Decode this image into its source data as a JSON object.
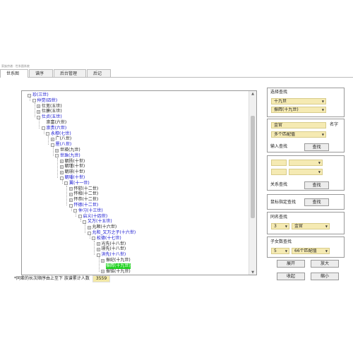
{
  "window": {
    "title": "家族宗谱 · 世系图系统"
  },
  "tabs": [
    "世系图",
    "谱序",
    "后台管理",
    "后记"
  ],
  "tree": {
    "nodes": [
      {
        "label": "珍(三世)",
        "level": 0,
        "toggle": "-",
        "blue": true
      },
      {
        "label": "仲觉(四世)",
        "level": 1,
        "toggle": "-",
        "blue": true
      },
      {
        "label": "仕宽(五世)",
        "level": 2,
        "toggle": "+",
        "blue": false
      },
      {
        "label": "仕廉(五世)",
        "level": 2,
        "toggle": "+",
        "blue": false
      },
      {
        "label": "仕贞(五世)",
        "level": 2,
        "toggle": "-",
        "blue": true
      },
      {
        "label": "崇富(六世)",
        "level": 3,
        "toggle": "",
        "blue": false
      },
      {
        "label": "崇贵(六世)",
        "level": 3,
        "toggle": "-",
        "blue": true
      },
      {
        "label": "永穆(七世)",
        "level": 4,
        "toggle": "-",
        "blue": true
      },
      {
        "label": "广(八世)",
        "level": 5,
        "toggle": "+",
        "blue": false
      },
      {
        "label": "厘(八世)",
        "level": 5,
        "toggle": "-",
        "blue": true
      },
      {
        "label": "世瑛(九世)",
        "level": 6,
        "toggle": "+",
        "blue": false
      },
      {
        "label": "世珠(九世)",
        "level": 6,
        "toggle": "-",
        "blue": true
      },
      {
        "label": "朝扬(十世)",
        "level": 7,
        "toggle": "+",
        "blue": false
      },
      {
        "label": "朝瑾(十世)",
        "level": 7,
        "toggle": "+",
        "blue": false
      },
      {
        "label": "朝璟(十世)",
        "level": 7,
        "toggle": "+",
        "blue": false
      },
      {
        "label": "朝璠(十世)",
        "level": 7,
        "toggle": "-",
        "blue": true
      },
      {
        "label": "翼(十一世)",
        "level": 8,
        "toggle": "-",
        "blue": true
      },
      {
        "label": "怀慰(十二世)",
        "level": 9,
        "toggle": "+",
        "blue": false
      },
      {
        "label": "怀相(十二世)",
        "level": 9,
        "toggle": "+",
        "blue": false
      },
      {
        "label": "怀恭(十二世)",
        "level": 9,
        "toggle": "+",
        "blue": false
      },
      {
        "label": "怀德(十二世)",
        "level": 9,
        "toggle": "-",
        "blue": true
      },
      {
        "label": "仲习(十三世)",
        "level": 10,
        "toggle": "-",
        "blue": true
      },
      {
        "label": "启义(十四世)",
        "level": 11,
        "toggle": "-",
        "blue": true
      },
      {
        "label": "又万(十五世)",
        "level": 12,
        "toggle": "-",
        "blue": true
      },
      {
        "label": "允顺(十六世)",
        "level": 13,
        "toggle": "+",
        "blue": false
      },
      {
        "label": "允和_又万之子(十六世)",
        "level": 13,
        "toggle": "-",
        "blue": true
      },
      {
        "label": "松德(十七世)",
        "level": 14,
        "toggle": "-",
        "blue": true
      },
      {
        "label": "光先(十八世)",
        "level": 15,
        "toggle": "+",
        "blue": false
      },
      {
        "label": "璟先(十八世)",
        "level": 15,
        "toggle": "+",
        "blue": false
      },
      {
        "label": "洪先(十八世)",
        "level": 15,
        "toggle": "-",
        "blue": true
      },
      {
        "label": "振纪(十九世)",
        "level": 16,
        "toggle": "+",
        "blue": false
      },
      {
        "label": "振辉(十九世)",
        "level": 16,
        "toggle": "",
        "blue": false,
        "selected": true
      },
      {
        "label": "振铭(十九世)",
        "level": 16,
        "toggle": "+",
        "blue": false
      }
    ]
  },
  "footer_note": {
    "text": "*同辈的长次顺序由上至下    族谱累计人数",
    "count": "3559"
  },
  "search_panel": {
    "select_search_label": "选择查找",
    "generation_value": "十九世",
    "person_value": "振辉(十九世)",
    "name_value": "金官",
    "name_label": "名字",
    "match_value": "多个匹配值",
    "input_search_label": "输入查找",
    "find_button": "查找",
    "relation_search_label": "关系查找",
    "relation_find_button": "查找",
    "mouse_search_label": "鼠标指定查找",
    "mouse_find_button": "查找",
    "same_name_label": "同名查找",
    "same_name_count": "3",
    "same_name_value": "金官",
    "children_label": "子女数查找",
    "children_count": "5",
    "children_match": "66个匹配值"
  },
  "controls": {
    "expand": "展开",
    "zoom_in": "放大",
    "collapse": "收起",
    "zoom_out": "缩小"
  }
}
